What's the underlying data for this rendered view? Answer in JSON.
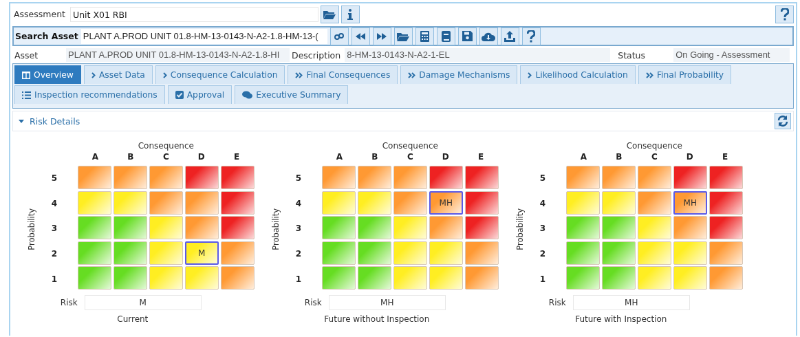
{
  "assessment": {
    "label": "Assessment",
    "value": "Unit X01 RBI"
  },
  "search": {
    "label": "Search Asset",
    "value": "PLANT A.PROD UNIT 01.8-HM-13-0143-N-A2-1.8-HM-13-("
  },
  "info": [
    {
      "label": "Asset",
      "value": "PLANT A.PROD UNIT 01.8-HM-13-0143-N-A2-1.8-HI"
    },
    {
      "label": "Description",
      "value": "8-HM-13-0143-N-A2-1-EL"
    },
    {
      "label": "Status",
      "value": "On Going - Assessment"
    }
  ],
  "tab_rows": [
    [
      {
        "label": "Overview",
        "selected": true
      },
      {
        "label": "Asset Data",
        "selected": false
      },
      {
        "label": "Consequence Calculation",
        "selected": false
      },
      {
        "label": "Final Consequences",
        "selected": false
      },
      {
        "label": "Damage Mechanisms",
        "selected": false
      },
      {
        "label": "Likelihood Calculation",
        "selected": false
      },
      {
        "label": "Final Probability",
        "selected": false
      }
    ],
    [
      {
        "label": "Inspection recommendations",
        "selected": false
      },
      {
        "label": "Approval",
        "selected": false
      },
      {
        "label": "Executive Summary",
        "selected": false
      }
    ]
  ],
  "section": {
    "title": "Risk Details",
    "expanded": true
  },
  "matrices": [
    {
      "x_title": "Consequence",
      "y_title": "Probability",
      "columns": [
        "A",
        "B",
        "C",
        "D",
        "E"
      ],
      "row_labels": [
        "5",
        "4",
        "3",
        "2",
        "1"
      ],
      "cells": [
        [
          {
            "color": "#ff9933",
            "selected": false
          },
          {
            "color": "#ff9933",
            "selected": false
          },
          {
            "color": "#ff9933",
            "selected": false
          },
          {
            "color": "#ee2222",
            "selected": false
          },
          {
            "color": "#ee2222",
            "selected": false
          }
        ],
        [
          {
            "color": "#ffee22",
            "selected": false
          },
          {
            "color": "#ffee22",
            "selected": false
          },
          {
            "color": "#ff9933",
            "selected": false
          },
          {
            "color": "#ff9933",
            "selected": false
          },
          {
            "color": "#ee2222",
            "selected": false
          }
        ],
        [
          {
            "color": "#66dd22",
            "selected": false
          },
          {
            "color": "#66dd22",
            "selected": false
          },
          {
            "color": "#ffee22",
            "selected": false
          },
          {
            "color": "#ff9933",
            "selected": false
          },
          {
            "color": "#ee2222",
            "selected": false
          }
        ],
        [
          {
            "color": "#66dd22",
            "selected": false
          },
          {
            "color": "#66dd22",
            "selected": false
          },
          {
            "color": "#ffee22",
            "selected": false
          },
          {
            "color": "#ffee22",
            "selected": true,
            "text": "M"
          },
          {
            "color": "#ff9933",
            "selected": false
          }
        ],
        [
          {
            "color": "#66dd22",
            "selected": false
          },
          {
            "color": "#66dd22",
            "selected": false
          },
          {
            "color": "#ffee22",
            "selected": false
          },
          {
            "color": "#ffee22",
            "selected": false
          },
          {
            "color": "#ff9933",
            "selected": false
          }
        ]
      ],
      "risk_label": "Risk",
      "risk_value": "M",
      "caption": "Current"
    },
    {
      "x_title": "Consequence",
      "y_title": "Probability",
      "columns": [
        "A",
        "B",
        "C",
        "D",
        "E"
      ],
      "row_labels": [
        "5",
        "4",
        "3",
        "2",
        "1"
      ],
      "cells": [
        [
          {
            "color": "#ff9933",
            "selected": false
          },
          {
            "color": "#ff9933",
            "selected": false
          },
          {
            "color": "#ff9933",
            "selected": false
          },
          {
            "color": "#ee2222",
            "selected": false
          },
          {
            "color": "#ee2222",
            "selected": false
          }
        ],
        [
          {
            "color": "#ffee22",
            "selected": false
          },
          {
            "color": "#ffee22",
            "selected": false
          },
          {
            "color": "#ff9933",
            "selected": false
          },
          {
            "color": "#ff9933",
            "selected": true,
            "text": "MH"
          },
          {
            "color": "#ee2222",
            "selected": false
          }
        ],
        [
          {
            "color": "#66dd22",
            "selected": false
          },
          {
            "color": "#66dd22",
            "selected": false
          },
          {
            "color": "#ffee22",
            "selected": false
          },
          {
            "color": "#ff9933",
            "selected": false
          },
          {
            "color": "#ee2222",
            "selected": false
          }
        ],
        [
          {
            "color": "#66dd22",
            "selected": false
          },
          {
            "color": "#66dd22",
            "selected": false
          },
          {
            "color": "#ffee22",
            "selected": false
          },
          {
            "color": "#ffee22",
            "selected": false
          },
          {
            "color": "#ff9933",
            "selected": false
          }
        ],
        [
          {
            "color": "#66dd22",
            "selected": false
          },
          {
            "color": "#66dd22",
            "selected": false
          },
          {
            "color": "#ffee22",
            "selected": false
          },
          {
            "color": "#ffee22",
            "selected": false
          },
          {
            "color": "#ff9933",
            "selected": false
          }
        ]
      ],
      "risk_label": "Risk",
      "risk_value": "MH",
      "caption": "Future without Inspection"
    },
    {
      "x_title": "Consequence",
      "y_title": "Probability",
      "columns": [
        "A",
        "B",
        "C",
        "D",
        "E"
      ],
      "row_labels": [
        "5",
        "4",
        "3",
        "2",
        "1"
      ],
      "cells": [
        [
          {
            "color": "#ff9933",
            "selected": false
          },
          {
            "color": "#ff9933",
            "selected": false
          },
          {
            "color": "#ff9933",
            "selected": false
          },
          {
            "color": "#ee2222",
            "selected": false
          },
          {
            "color": "#ee2222",
            "selected": false
          }
        ],
        [
          {
            "color": "#ffee22",
            "selected": false
          },
          {
            "color": "#ffee22",
            "selected": false
          },
          {
            "color": "#ff9933",
            "selected": false
          },
          {
            "color": "#ff9933",
            "selected": true,
            "text": "MH"
          },
          {
            "color": "#ee2222",
            "selected": false
          }
        ],
        [
          {
            "color": "#66dd22",
            "selected": false
          },
          {
            "color": "#66dd22",
            "selected": false
          },
          {
            "color": "#ffee22",
            "selected": false
          },
          {
            "color": "#ff9933",
            "selected": false
          },
          {
            "color": "#ee2222",
            "selected": false
          }
        ],
        [
          {
            "color": "#66dd22",
            "selected": false
          },
          {
            "color": "#66dd22",
            "selected": false
          },
          {
            "color": "#ffee22",
            "selected": false
          },
          {
            "color": "#ffee22",
            "selected": false
          },
          {
            "color": "#ff9933",
            "selected": false
          }
        ],
        [
          {
            "color": "#66dd22",
            "selected": false
          },
          {
            "color": "#66dd22",
            "selected": false
          },
          {
            "color": "#ffee22",
            "selected": false
          },
          {
            "color": "#ffee22",
            "selected": false
          },
          {
            "color": "#ff9933",
            "selected": false
          }
        ]
      ],
      "risk_label": "Risk",
      "risk_value": "MH",
      "caption": "Future with Inspection"
    }
  ]
}
